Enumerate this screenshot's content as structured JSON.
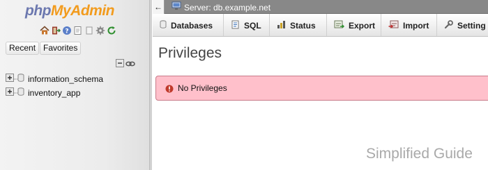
{
  "navigation": {
    "logo": {
      "php": "php",
      "my": "My",
      "admin": "Admin"
    },
    "icons": [
      "home-icon",
      "logout-icon",
      "help-icon",
      "documentation-icon",
      "settings-icon",
      "reload-icon"
    ],
    "tabs": {
      "recent": "Recent",
      "favorites": "Favorites"
    },
    "databases": [
      "information_schema",
      "inventory_app"
    ]
  },
  "breadcrumb": {
    "back_label": "←",
    "server_label": "Server: db.example.net"
  },
  "menu": {
    "tabs": [
      {
        "label": "Databases",
        "icon": "database-icon"
      },
      {
        "label": "SQL",
        "icon": "sql-icon"
      },
      {
        "label": "Status",
        "icon": "status-icon"
      },
      {
        "label": "Export",
        "icon": "export-icon"
      },
      {
        "label": "Import",
        "icon": "import-icon"
      },
      {
        "label": "Setting",
        "icon": "settings-icon"
      }
    ]
  },
  "main": {
    "title": "Privileges",
    "error_message": "No Privileges"
  },
  "watermark": "Simplified Guide",
  "colors": {
    "error_background": "#ffc0cb",
    "breadcrumb_background": "#888888",
    "logo_blue": "#6c78af",
    "logo_orange": "#f29b1d"
  }
}
